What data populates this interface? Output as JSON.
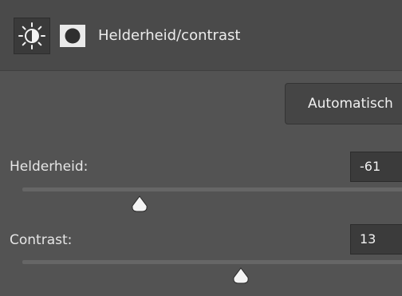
{
  "panel": {
    "title": "Helderheid/contrast",
    "icons": {
      "brightness": "sun-brightness-icon",
      "mask": "layer-mask-icon"
    }
  },
  "auto_button": {
    "label": "Automatisch"
  },
  "brightness": {
    "label": "Helderheid:",
    "value": "-61",
    "slider_fraction": 0.3
  },
  "contrast": {
    "label": "Contrast:",
    "value": "13",
    "slider_fraction": 0.56
  },
  "colors": {
    "panel_bg": "#535353",
    "header_bg": "#4a4a4a",
    "track": "#666666",
    "thumb": "#f4f4f4",
    "text": "#e8e8e8"
  }
}
